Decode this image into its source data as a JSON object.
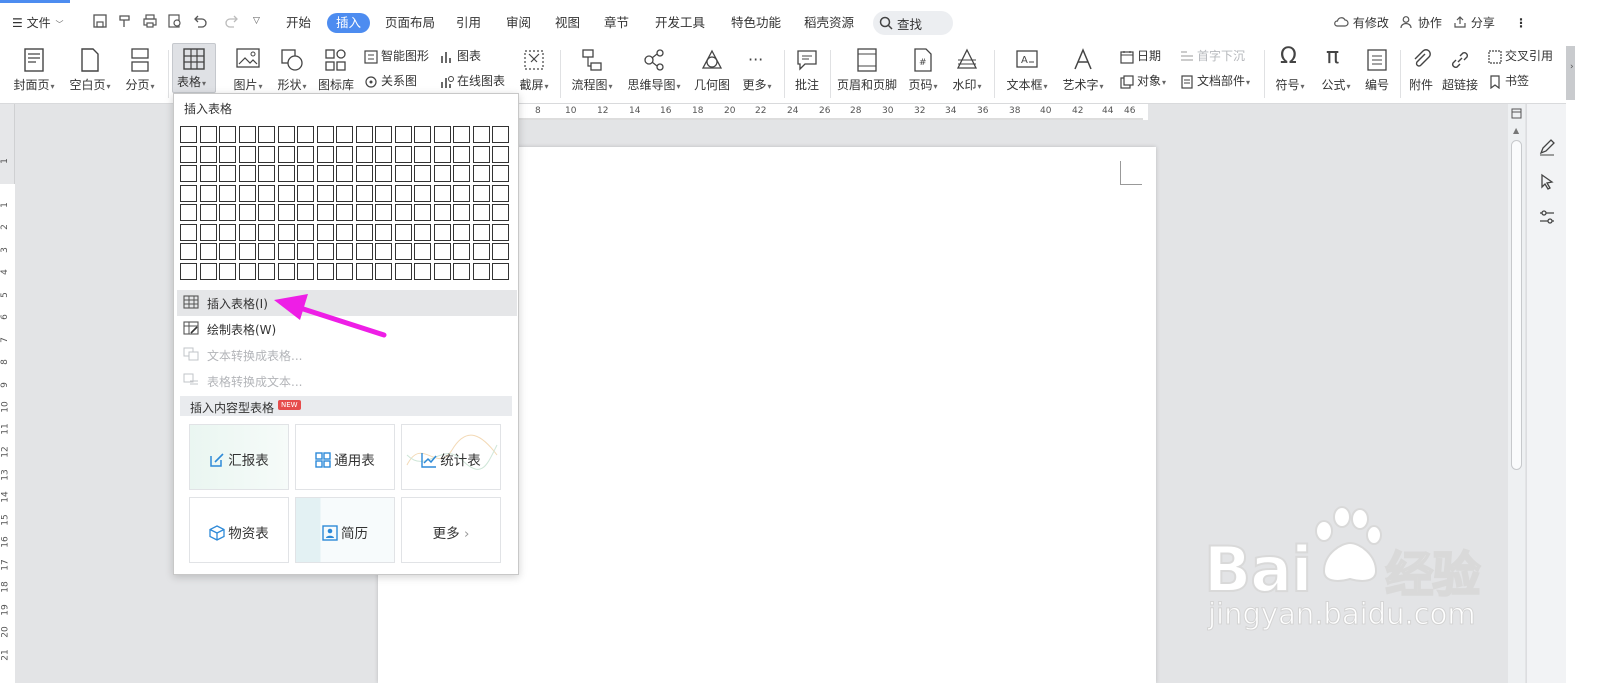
{
  "menubar": {
    "file_label": "文件",
    "tabs": [
      {
        "label": "开始"
      },
      {
        "label": "插入"
      },
      {
        "label": "页面布局"
      },
      {
        "label": "引用"
      },
      {
        "label": "审阅"
      },
      {
        "label": "视图"
      },
      {
        "label": "章节"
      },
      {
        "label": "开发工具"
      },
      {
        "label": "特色功能"
      },
      {
        "label": "稻壳资源"
      }
    ],
    "search_label": "查找",
    "modified_label": "有修改",
    "collab_label": "协作",
    "share_label": "分享"
  },
  "ribbon": {
    "cover": "封面页",
    "blank": "空白页",
    "pagebreak": "分页",
    "table": "表格",
    "picture": "图片",
    "shape": "形状",
    "iconlib": "图标库",
    "smartshape": "智能图形",
    "chart": "图表",
    "relation": "关系图",
    "onlinechart": "在线图表",
    "screenshot": "截屏",
    "flowchart": "流程图",
    "mindmap": "思维导图",
    "geometry": "几何图",
    "more": "更多",
    "comment": "批注",
    "header_footer": "页眉和页脚",
    "pagenum": "页码",
    "watermark": "水印",
    "textbox": "文本框",
    "wordart": "艺术字",
    "date": "日期",
    "object": "对象",
    "dropcap": "首字下沉",
    "docpart": "文档部件",
    "symbol": "符号",
    "formula": "公式",
    "numbering": "编号",
    "attachment": "附件",
    "hyperlink": "超链接",
    "crossref": "交叉引用",
    "bookmark": "书签"
  },
  "ruler": {
    "ticks": [
      "8",
      "10",
      "12",
      "14",
      "16",
      "18",
      "20",
      "22",
      "24",
      "26",
      "28",
      "30",
      "32",
      "34",
      "36",
      "38",
      "40",
      "42",
      "44",
      "46"
    ],
    "vticks": [
      "1",
      "1",
      "2",
      "3",
      "4",
      "5",
      "6",
      "7",
      "8",
      "9",
      "10",
      "11",
      "12",
      "13",
      "14",
      "15",
      "16",
      "17",
      "18",
      "19",
      "20",
      "21"
    ]
  },
  "dropdown": {
    "header": "插入表格",
    "insert_table": "插入表格(I)",
    "draw_table": "绘制表格(W)",
    "text_to_table": "文本转换成表格...",
    "table_to_text": "表格转换成文本...",
    "content_section": "插入内容型表格",
    "new_badge": "NEW",
    "cards": {
      "report": "汇报表",
      "general": "通用表",
      "stats": "统计表",
      "materials": "物资表",
      "resume": "简历",
      "more": "更多"
    }
  },
  "watermark": {
    "brand": "Bai",
    "jy": "经验",
    "url": "jingyan.baidu.com"
  },
  "colors": {
    "accent": "#4d8cf0",
    "arrow": "#ee1ee6"
  }
}
